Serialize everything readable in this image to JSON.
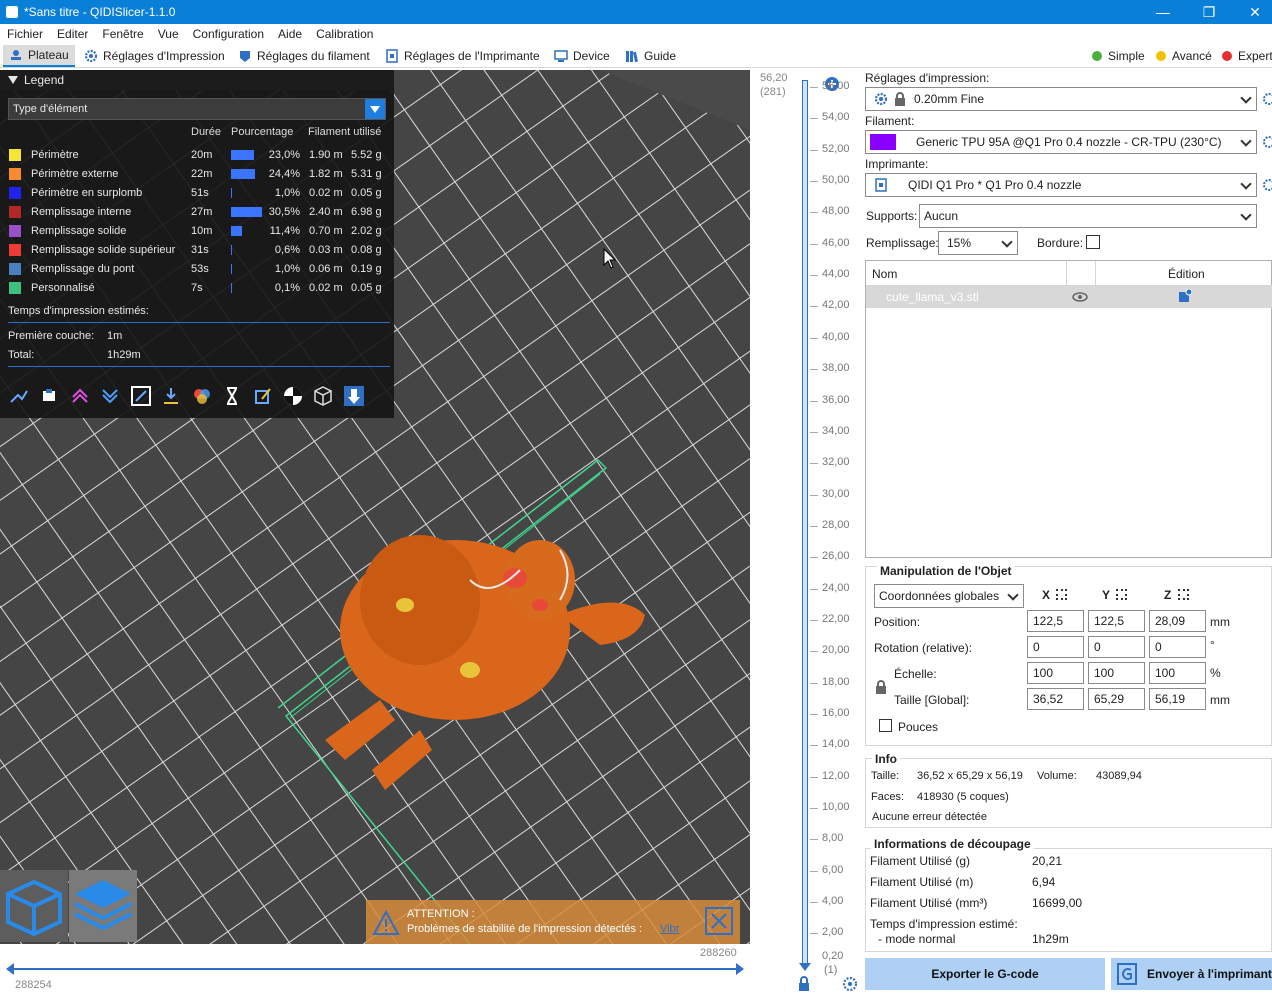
{
  "window": {
    "title": "*Sans titre - QIDISlicer-1.1.0"
  },
  "menu": [
    "Fichier",
    "Editer",
    "Fenêtre",
    "Vue",
    "Configuration",
    "Aide",
    "Calibration"
  ],
  "tabs": [
    {
      "label": "Plateau",
      "icon": "plate-icon"
    },
    {
      "label": "Réglages d'Impression",
      "icon": "gear-icon"
    },
    {
      "label": "Réglages du filament",
      "icon": "filament-spool-icon"
    },
    {
      "label": "Réglages de l'Imprimante",
      "icon": "printer-icon"
    },
    {
      "label": "Device",
      "icon": "device-icon"
    },
    {
      "label": "Guide",
      "icon": "guide-icon"
    }
  ],
  "modes": [
    {
      "label": "Simple",
      "color": "#4caf3a"
    },
    {
      "label": "Avancé",
      "color": "#f2c200"
    },
    {
      "label": "Expert",
      "color": "#e53030"
    }
  ],
  "legend": {
    "title": "Legend",
    "feature_type": "Type d'élément",
    "columns": [
      "Durée",
      "Pourcentage",
      "Filament utilisé"
    ],
    "items": [
      {
        "name": "Périmètre",
        "color": "#f5e53a",
        "time": "20m",
        "percent": "23,0%",
        "pct": 23.0,
        "length": "1.90 m",
        "weight": "5.52 g"
      },
      {
        "name": "Périmètre externe",
        "color": "#f58a2e",
        "time": "22m",
        "percent": "24,4%",
        "pct": 24.4,
        "length": "1.82 m",
        "weight": "5.31 g"
      },
      {
        "name": "Périmètre en surplomb",
        "color": "#2222ee",
        "time": "51s",
        "percent": "1,0%",
        "pct": 1.0,
        "length": "0.02 m",
        "weight": "0.05 g"
      },
      {
        "name": "Remplissage interne",
        "color": "#b02828",
        "time": "27m",
        "percent": "30,5%",
        "pct": 30.5,
        "length": "2.40 m",
        "weight": "6.98 g"
      },
      {
        "name": "Remplissage solide",
        "color": "#9a50c8",
        "time": "10m",
        "percent": "11,4%",
        "pct": 11.4,
        "length": "0.70 m",
        "weight": "2.02 g"
      },
      {
        "name": "Remplissage solide supérieur",
        "color": "#f03a3a",
        "time": "31s",
        "percent": "0,6%",
        "pct": 0.6,
        "length": "0.03 m",
        "weight": "0.08 g"
      },
      {
        "name": "Remplissage du pont",
        "color": "#4a80c0",
        "time": "53s",
        "percent": "1,0%",
        "pct": 1.0,
        "length": "0.06 m",
        "weight": "0.19 g"
      },
      {
        "name": "Personnalisé",
        "color": "#40c080",
        "time": "7s",
        "percent": "0,1%",
        "pct": 0.1,
        "length": "0.02 m",
        "weight": "0.05 g"
      }
    ],
    "estimated_title": "Temps d'impression estimés:",
    "first_layer_label": "Première couche:",
    "first_layer_value": "1m",
    "total_label": "Total:",
    "total_value": "1h29m"
  },
  "warning": {
    "title": "ATTENTION :",
    "text": "Problèmes de stabilité de l'impression détectés :",
    "link": "Vibr"
  },
  "hslider": {
    "left": "288254",
    "right": "288260"
  },
  "vslider": {
    "top_value": "56,20",
    "top_layer": "(281)",
    "bottom_value": "0,20",
    "bottom_layer": "(1)",
    "ticks": [
      "56,00",
      "54,00",
      "52,00",
      "50,00",
      "48,00",
      "46,00",
      "44,00",
      "42,00",
      "40,00",
      "38,00",
      "36,00",
      "34,00",
      "32,00",
      "30,00",
      "28,00",
      "26,00",
      "24,00",
      "22,00",
      "20,00",
      "18,00",
      "16,00",
      "14,00",
      "12,00",
      "10,00",
      "8,00",
      "6,00",
      "4,00",
      "2,00"
    ]
  },
  "sidebar": {
    "print_settings_label": "Réglages d'impression:",
    "print_settings_value": "0.20mm Fine",
    "filament_label": "Filament:",
    "filament_value": "Generic TPU 95A @Q1 Pro 0.4 nozzle - CR-TPU (230°C)",
    "filament_color": "#8a00ff",
    "printer_label": "Imprimante:",
    "printer_value": "QIDI Q1 Pro * Q1 Pro 0.4 nozzle",
    "supports_label": "Supports:",
    "supports_value": "Aucun",
    "infill_label": "Remplissage:",
    "infill_value": "15%",
    "brim_label": "Bordure:",
    "object_list": {
      "col_name": "Nom",
      "col_edit": "Édition",
      "object": "cute_llama_v3.stl"
    },
    "manip": {
      "title": "Manipulation de l'Objet",
      "coord_system": "Coordonnées globales",
      "axes": [
        "X",
        "Y",
        "Z"
      ],
      "position_label": "Position:",
      "position": [
        "122,5",
        "122,5",
        "28,09"
      ],
      "position_unit": "mm",
      "rotation_label": "Rotation (relative):",
      "rotation": [
        "0",
        "0",
        "0"
      ],
      "rotation_unit": "°",
      "scale_label": "Échelle:",
      "scale": [
        "100",
        "100",
        "100"
      ],
      "scale_unit": "%",
      "size_label": "Taille [Global]:",
      "size": [
        "36,52",
        "65,29",
        "56,19"
      ],
      "size_unit": "mm",
      "inches_label": "Pouces"
    },
    "info": {
      "title": "Info",
      "size_label": "Taille:",
      "size_value": "36,52 x 65,29 x 56,19",
      "volume_label": "Volume:",
      "volume_value": "43089,94",
      "faces_label": "Faces:",
      "faces_value": "418930 (5 coques)",
      "errors": "Aucune erreur détectée"
    },
    "slice_info": {
      "title": "Informations de découpage",
      "rows": [
        {
          "label": "Filament Utilisé (g)",
          "value": "20,21"
        },
        {
          "label": "Filament Utilisé (m)",
          "value": "6,94"
        },
        {
          "label": "Filament Utilisé (mm³)",
          "value": "16699,00"
        }
      ],
      "est_label": "Temps d'impression estimé:",
      "mode_label": "- mode normal",
      "mode_value": "1h29m"
    },
    "export_label": "Exporter le G-code",
    "send_label": "Envoyer à l'imprimante"
  }
}
